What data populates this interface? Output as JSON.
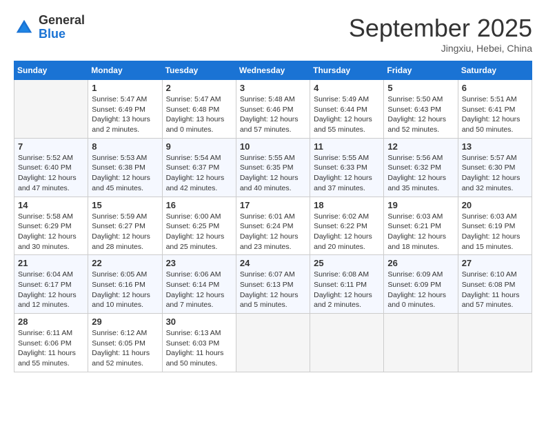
{
  "header": {
    "logo": {
      "general": "General",
      "blue": "Blue"
    },
    "title": "September 2025",
    "location": "Jingxiu, Hebei, China"
  },
  "days_of_week": [
    "Sunday",
    "Monday",
    "Tuesday",
    "Wednesday",
    "Thursday",
    "Friday",
    "Saturday"
  ],
  "weeks": [
    [
      {
        "day": "",
        "info": ""
      },
      {
        "day": "1",
        "info": "Sunrise: 5:47 AM\nSunset: 6:49 PM\nDaylight: 13 hours\nand 2 minutes."
      },
      {
        "day": "2",
        "info": "Sunrise: 5:47 AM\nSunset: 6:48 PM\nDaylight: 13 hours\nand 0 minutes."
      },
      {
        "day": "3",
        "info": "Sunrise: 5:48 AM\nSunset: 6:46 PM\nDaylight: 12 hours\nand 57 minutes."
      },
      {
        "day": "4",
        "info": "Sunrise: 5:49 AM\nSunset: 6:44 PM\nDaylight: 12 hours\nand 55 minutes."
      },
      {
        "day": "5",
        "info": "Sunrise: 5:50 AM\nSunset: 6:43 PM\nDaylight: 12 hours\nand 52 minutes."
      },
      {
        "day": "6",
        "info": "Sunrise: 5:51 AM\nSunset: 6:41 PM\nDaylight: 12 hours\nand 50 minutes."
      }
    ],
    [
      {
        "day": "7",
        "info": "Sunrise: 5:52 AM\nSunset: 6:40 PM\nDaylight: 12 hours\nand 47 minutes."
      },
      {
        "day": "8",
        "info": "Sunrise: 5:53 AM\nSunset: 6:38 PM\nDaylight: 12 hours\nand 45 minutes."
      },
      {
        "day": "9",
        "info": "Sunrise: 5:54 AM\nSunset: 6:37 PM\nDaylight: 12 hours\nand 42 minutes."
      },
      {
        "day": "10",
        "info": "Sunrise: 5:55 AM\nSunset: 6:35 PM\nDaylight: 12 hours\nand 40 minutes."
      },
      {
        "day": "11",
        "info": "Sunrise: 5:55 AM\nSunset: 6:33 PM\nDaylight: 12 hours\nand 37 minutes."
      },
      {
        "day": "12",
        "info": "Sunrise: 5:56 AM\nSunset: 6:32 PM\nDaylight: 12 hours\nand 35 minutes."
      },
      {
        "day": "13",
        "info": "Sunrise: 5:57 AM\nSunset: 6:30 PM\nDaylight: 12 hours\nand 32 minutes."
      }
    ],
    [
      {
        "day": "14",
        "info": "Sunrise: 5:58 AM\nSunset: 6:29 PM\nDaylight: 12 hours\nand 30 minutes."
      },
      {
        "day": "15",
        "info": "Sunrise: 5:59 AM\nSunset: 6:27 PM\nDaylight: 12 hours\nand 28 minutes."
      },
      {
        "day": "16",
        "info": "Sunrise: 6:00 AM\nSunset: 6:25 PM\nDaylight: 12 hours\nand 25 minutes."
      },
      {
        "day": "17",
        "info": "Sunrise: 6:01 AM\nSunset: 6:24 PM\nDaylight: 12 hours\nand 23 minutes."
      },
      {
        "day": "18",
        "info": "Sunrise: 6:02 AM\nSunset: 6:22 PM\nDaylight: 12 hours\nand 20 minutes."
      },
      {
        "day": "19",
        "info": "Sunrise: 6:03 AM\nSunset: 6:21 PM\nDaylight: 12 hours\nand 18 minutes."
      },
      {
        "day": "20",
        "info": "Sunrise: 6:03 AM\nSunset: 6:19 PM\nDaylight: 12 hours\nand 15 minutes."
      }
    ],
    [
      {
        "day": "21",
        "info": "Sunrise: 6:04 AM\nSunset: 6:17 PM\nDaylight: 12 hours\nand 12 minutes."
      },
      {
        "day": "22",
        "info": "Sunrise: 6:05 AM\nSunset: 6:16 PM\nDaylight: 12 hours\nand 10 minutes."
      },
      {
        "day": "23",
        "info": "Sunrise: 6:06 AM\nSunset: 6:14 PM\nDaylight: 12 hours\nand 7 minutes."
      },
      {
        "day": "24",
        "info": "Sunrise: 6:07 AM\nSunset: 6:13 PM\nDaylight: 12 hours\nand 5 minutes."
      },
      {
        "day": "25",
        "info": "Sunrise: 6:08 AM\nSunset: 6:11 PM\nDaylight: 12 hours\nand 2 minutes."
      },
      {
        "day": "26",
        "info": "Sunrise: 6:09 AM\nSunset: 6:09 PM\nDaylight: 12 hours\nand 0 minutes."
      },
      {
        "day": "27",
        "info": "Sunrise: 6:10 AM\nSunset: 6:08 PM\nDaylight: 11 hours\nand 57 minutes."
      }
    ],
    [
      {
        "day": "28",
        "info": "Sunrise: 6:11 AM\nSunset: 6:06 PM\nDaylight: 11 hours\nand 55 minutes."
      },
      {
        "day": "29",
        "info": "Sunrise: 6:12 AM\nSunset: 6:05 PM\nDaylight: 11 hours\nand 52 minutes."
      },
      {
        "day": "30",
        "info": "Sunrise: 6:13 AM\nSunset: 6:03 PM\nDaylight: 11 hours\nand 50 minutes."
      },
      {
        "day": "",
        "info": ""
      },
      {
        "day": "",
        "info": ""
      },
      {
        "day": "",
        "info": ""
      },
      {
        "day": "",
        "info": ""
      }
    ]
  ]
}
